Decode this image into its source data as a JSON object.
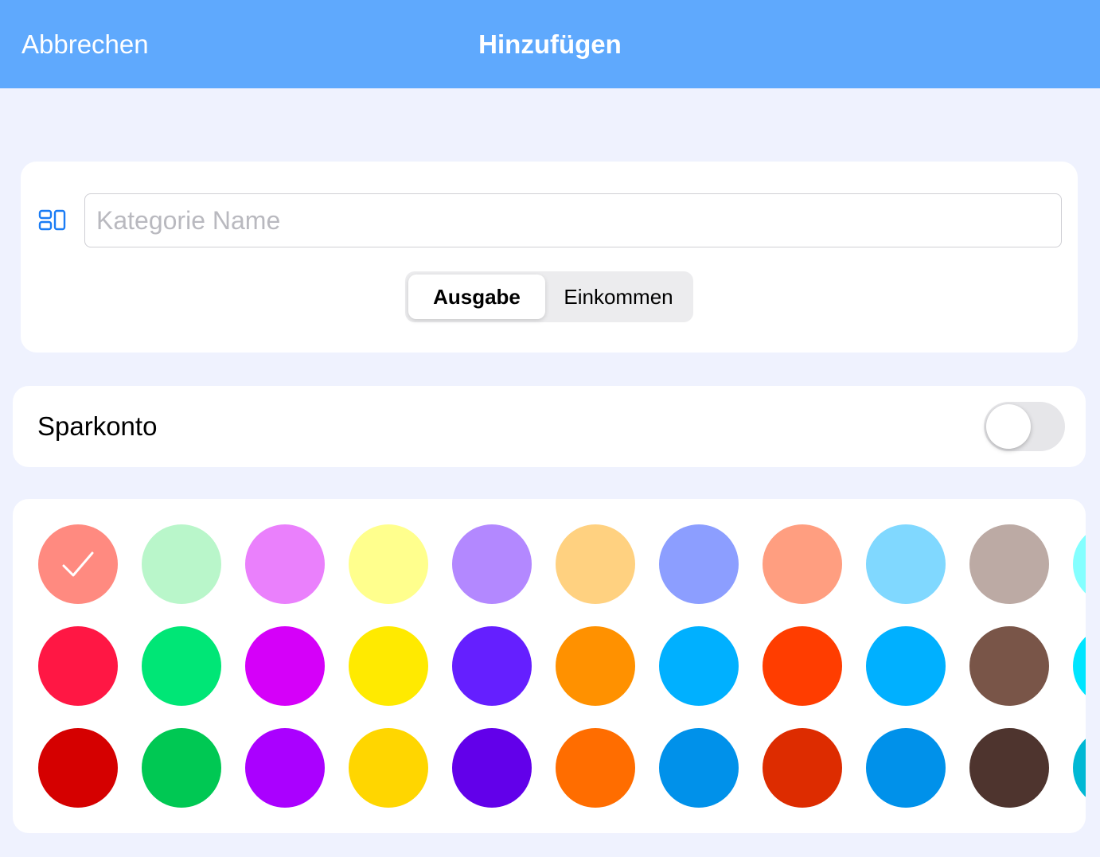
{
  "navbar": {
    "cancel_label": "Abbrechen",
    "title": "Hinzufügen"
  },
  "form": {
    "name_placeholder": "Kategorie Name",
    "name_value": "",
    "type_options": [
      "Ausgabe",
      "Einkommen"
    ],
    "type_selected": "Ausgabe"
  },
  "savings": {
    "label": "Sparkonto",
    "enabled": false
  },
  "colors": {
    "selected": "#ff8a80",
    "rows": [
      [
        "#ff8a80",
        "#b9f6ca",
        "#ea80fc",
        "#ffff8d",
        "#b388ff",
        "#ffd180",
        "#8c9eff",
        "#ff9e80",
        "#80d8ff",
        "#bcaaa4",
        "#84ffff"
      ],
      [
        "#ff1744",
        "#00e676",
        "#d500f9",
        "#ffea00",
        "#651fff",
        "#ff9100",
        "#00b0ff",
        "#ff3d00",
        "#00b0ff",
        "#795548",
        "#00e5ff"
      ],
      [
        "#d50000",
        "#00c853",
        "#aa00ff",
        "#ffd600",
        "#6200ea",
        "#ff6d00",
        "#0091ea",
        "#dd2c00",
        "#0091ea",
        "#4e342e",
        "#00b8d4"
      ]
    ]
  }
}
